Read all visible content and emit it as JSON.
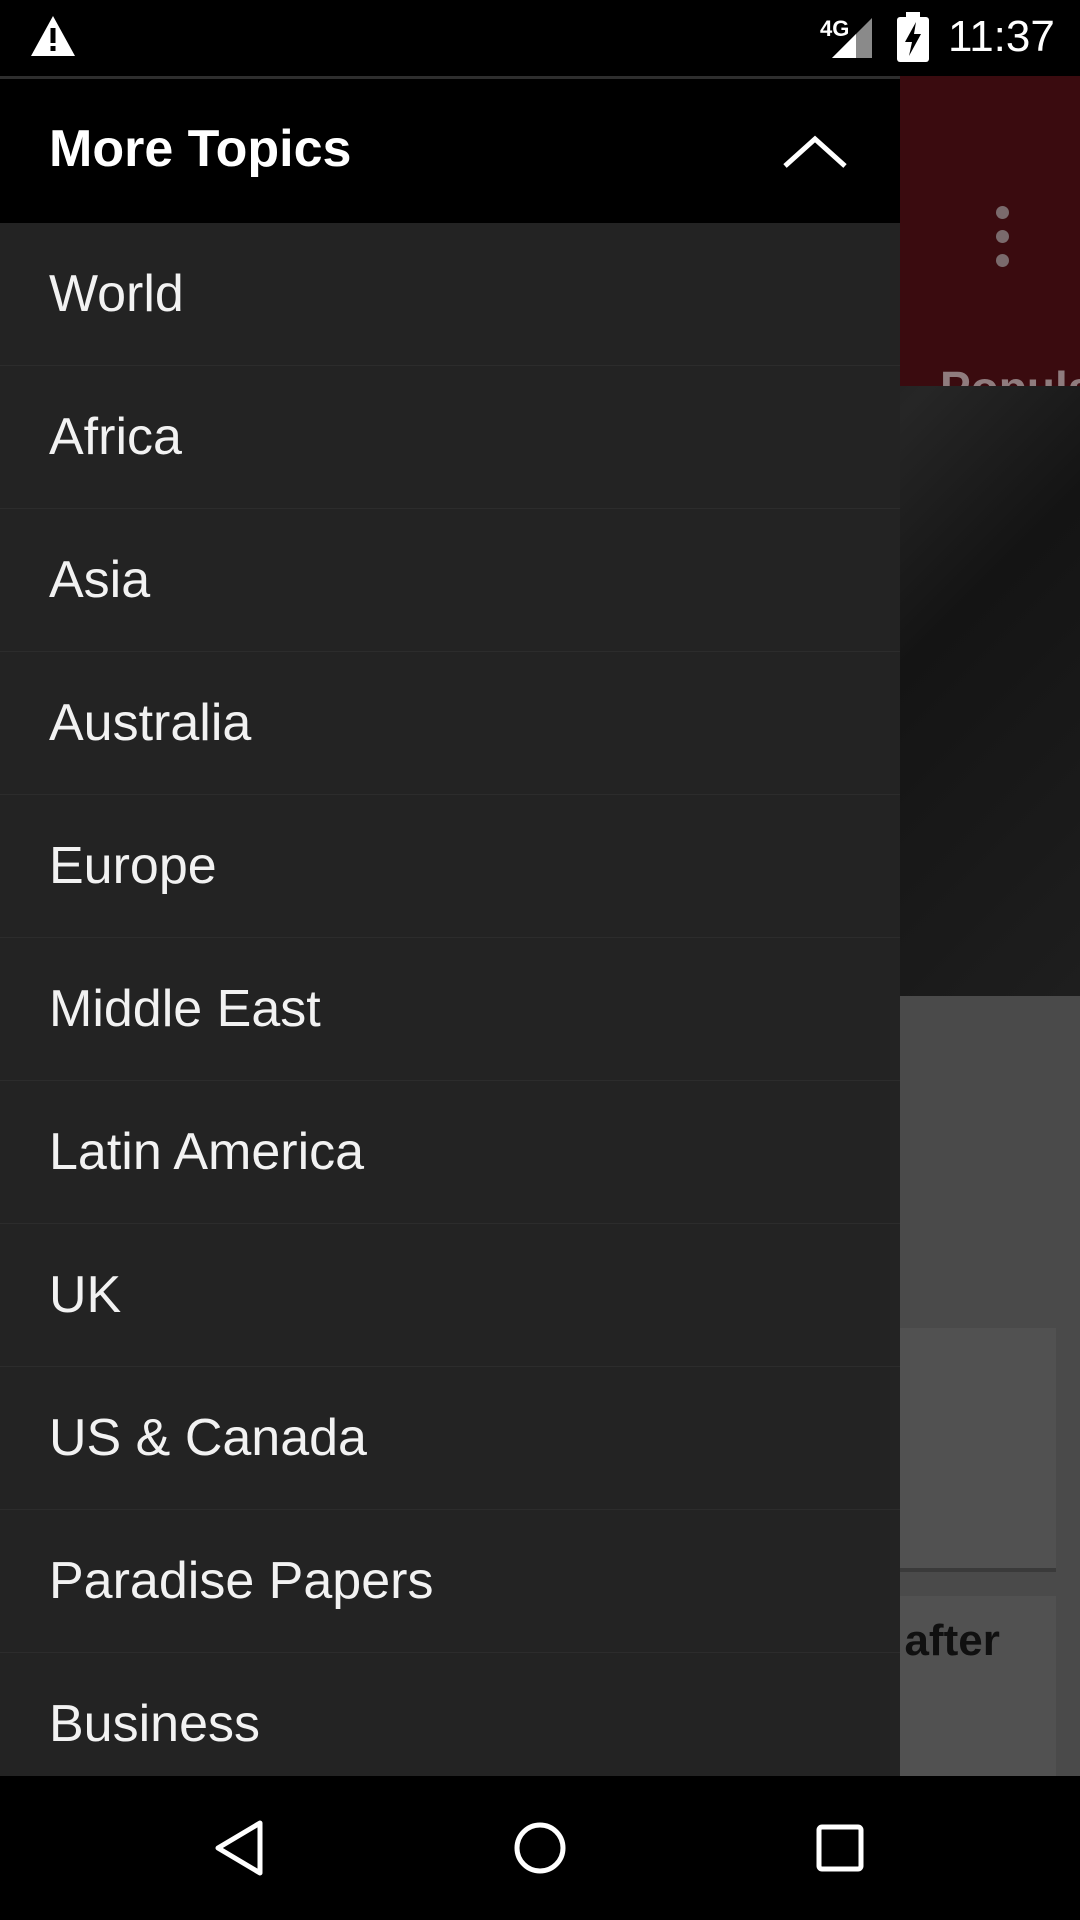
{
  "status_bar": {
    "network": "4G",
    "time": "11:37",
    "icons": [
      "warning-icon",
      "signal-icon",
      "battery-charging-icon"
    ]
  },
  "background": {
    "tab_partial": "Popula",
    "headline_partial": "l after"
  },
  "drawer": {
    "title": "More Topics",
    "collapse_icon": "chevron-up-icon",
    "items": [
      {
        "label": "World"
      },
      {
        "label": "Africa"
      },
      {
        "label": "Asia"
      },
      {
        "label": "Australia"
      },
      {
        "label": "Europe"
      },
      {
        "label": "Middle East"
      },
      {
        "label": "Latin America"
      },
      {
        "label": "UK"
      },
      {
        "label": "US & Canada"
      },
      {
        "label": "Paradise Papers"
      },
      {
        "label": "Business"
      }
    ]
  },
  "nav_bar": {
    "icons": [
      "back-icon",
      "home-icon",
      "recents-icon"
    ]
  },
  "colors": {
    "drawer_bg": "#232323",
    "header_bg": "#000000",
    "toolbar_bg": "#3a0b0f"
  }
}
